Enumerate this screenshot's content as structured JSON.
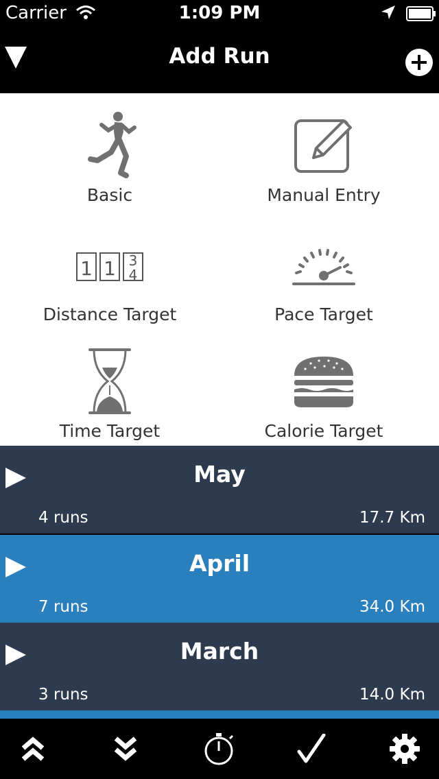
{
  "status_bar": {
    "carrier": "Carrier",
    "time": "1:09 PM"
  },
  "nav": {
    "title": "Add Run"
  },
  "options": [
    {
      "label": "Basic",
      "icon": "runner-icon"
    },
    {
      "label": "Manual Entry",
      "icon": "edit-pencil-icon"
    },
    {
      "label": "Distance Target",
      "icon": "odometer-icon"
    },
    {
      "label": "Pace Target",
      "icon": "speedometer-icon"
    },
    {
      "label": "Time Target",
      "icon": "hourglass-icon"
    },
    {
      "label": "Calorie Target",
      "icon": "burger-icon"
    }
  ],
  "months": [
    {
      "name": "May",
      "runs": "4 runs",
      "distance": "17.7 Km",
      "color": "#2e3b4f"
    },
    {
      "name": "April",
      "runs": "7 runs",
      "distance": "34.0 Km",
      "color": "#2a7fbd"
    },
    {
      "name": "March",
      "runs": "3 runs",
      "distance": "14.0 Km",
      "color": "#2e3b4f"
    }
  ],
  "tabs": [
    {
      "icon": "chevrons-up-icon"
    },
    {
      "icon": "chevrons-down-icon"
    },
    {
      "icon": "stopwatch-icon"
    },
    {
      "icon": "checkmark-icon"
    },
    {
      "icon": "gear-icon"
    }
  ]
}
